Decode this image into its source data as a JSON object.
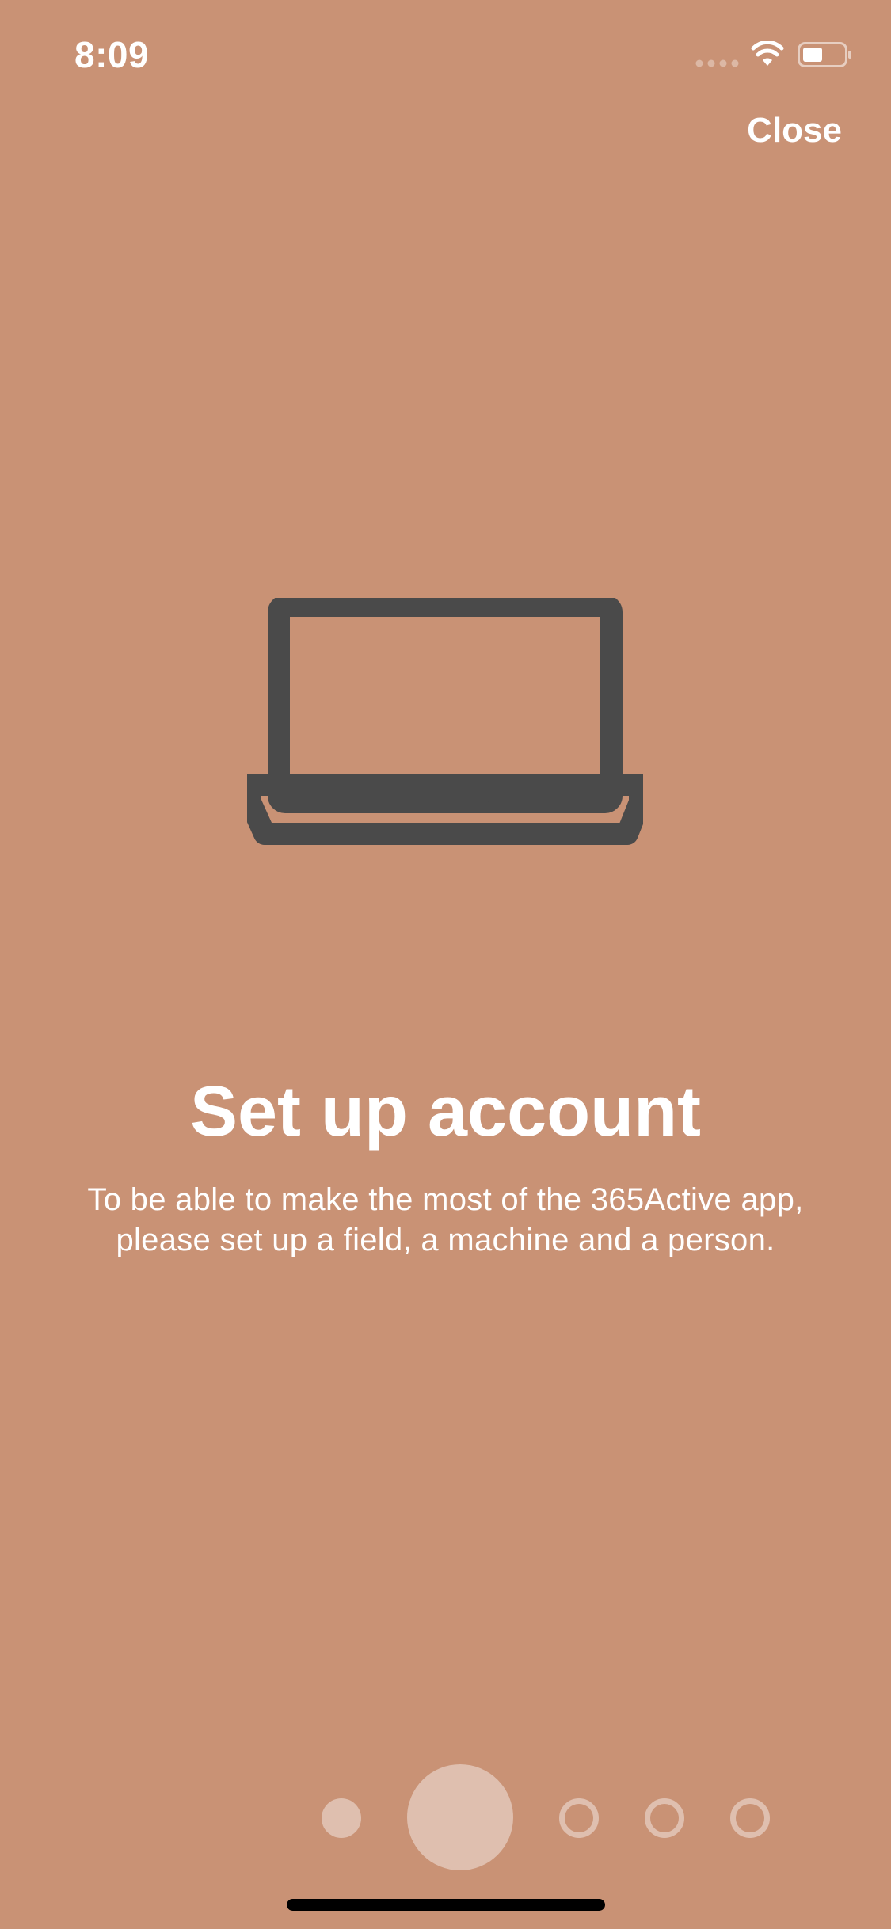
{
  "status_bar": {
    "time": "8:09"
  },
  "header": {
    "close_label": "Close"
  },
  "onboarding": {
    "icon": "laptop-icon",
    "title": "Set up account",
    "description": "To be able to make the most of the 365Active app, please set up a field, a machine and a person."
  },
  "pager": {
    "page_count": 5,
    "current_page": 2
  },
  "colors": {
    "background": "#c99275",
    "icon": "#4a4a4a",
    "text": "#ffffff"
  }
}
